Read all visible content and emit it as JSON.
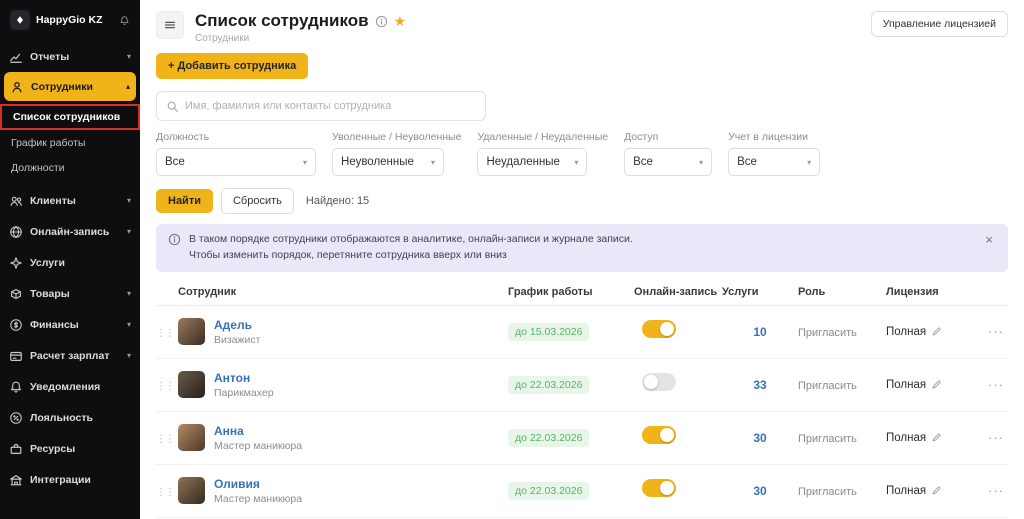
{
  "sidebar": {
    "logo_text": "HappyGio KZ",
    "items": [
      {
        "label": "Отчеты",
        "icon": "reports-icon"
      },
      {
        "label": "Сотрудники",
        "icon": "employees-icon",
        "active": true
      },
      {
        "label": "Клиенты",
        "icon": "clients-icon"
      },
      {
        "label": "Онлайн-запись",
        "icon": "online-booking-icon"
      },
      {
        "label": "Услуги",
        "icon": "services-icon"
      },
      {
        "label": "Товары",
        "icon": "goods-icon"
      },
      {
        "label": "Финансы",
        "icon": "finances-icon"
      },
      {
        "label": "Расчет зарплат",
        "icon": "salary-icon"
      },
      {
        "label": "Уведомления",
        "icon": "notifications-icon"
      },
      {
        "label": "Лояльность",
        "icon": "loyalty-icon"
      },
      {
        "label": "Ресурсы",
        "icon": "resources-icon"
      },
      {
        "label": "Интеграции",
        "icon": "integrations-icon"
      }
    ],
    "submenu": [
      {
        "label": "Список сотрудников",
        "selected": true
      },
      {
        "label": "График работы"
      },
      {
        "label": "Должности"
      }
    ]
  },
  "header": {
    "title": "Список сотрудников",
    "breadcrumb": "Сотрудники",
    "license_button": "Управление лицензией"
  },
  "toolbar": {
    "add_button": "+ Добавить сотрудника",
    "search_placeholder": "Имя, фамилия или контакты сотрудника"
  },
  "filters": [
    {
      "label": "Должность",
      "value": "Все"
    },
    {
      "label": "Уволенные / Неуволенные",
      "value": "Неуволенные"
    },
    {
      "label": "Удаленные / Неудаленные",
      "value": "Неудаленные"
    },
    {
      "label": "Доступ",
      "value": "Все"
    },
    {
      "label": "Учет в лицензии",
      "value": "Все"
    }
  ],
  "actions": {
    "find": "Найти",
    "reset": "Сбросить",
    "found": "Найдено: 15"
  },
  "banner": {
    "line1": "В таком порядке сотрудники отображаются в аналитике, онлайн-записи и журнале записи.",
    "line2": "Чтобы изменить порядок, перетяните сотрудника вверх или вниз"
  },
  "table": {
    "headers": [
      "Сотрудник",
      "График работы",
      "Онлайн-запись",
      "Услуги",
      "Роль",
      "Лицензия"
    ],
    "rows": [
      {
        "name": "Адель",
        "position": "Визажист",
        "schedule": "до 15.03.2026",
        "online_booking": true,
        "services": "10",
        "role": "Пригласить",
        "license": "Полная"
      },
      {
        "name": "Антон",
        "position": "Парикмахер",
        "schedule": "до 22.03.2026",
        "online_booking": false,
        "services": "33",
        "role": "Пригласить",
        "license": "Полная"
      },
      {
        "name": "Анна",
        "position": "Мастер маникюра",
        "schedule": "до 22.03.2026",
        "online_booking": true,
        "services": "30",
        "role": "Пригласить",
        "license": "Полная"
      },
      {
        "name": "Оливия",
        "position": "Мастер маникюра",
        "schedule": "до 22.03.2026",
        "online_booking": true,
        "services": "30",
        "role": "Пригласить",
        "license": "Полная"
      }
    ]
  },
  "colors": {
    "accent": "#f0b319",
    "highlight_border": "#d93025",
    "link": "#3573b9",
    "badge_bg": "#e7f6e9",
    "badge_text": "#56b365",
    "banner_bg": "#e9e7f8",
    "sidebar_bg": "#0e0e10"
  }
}
